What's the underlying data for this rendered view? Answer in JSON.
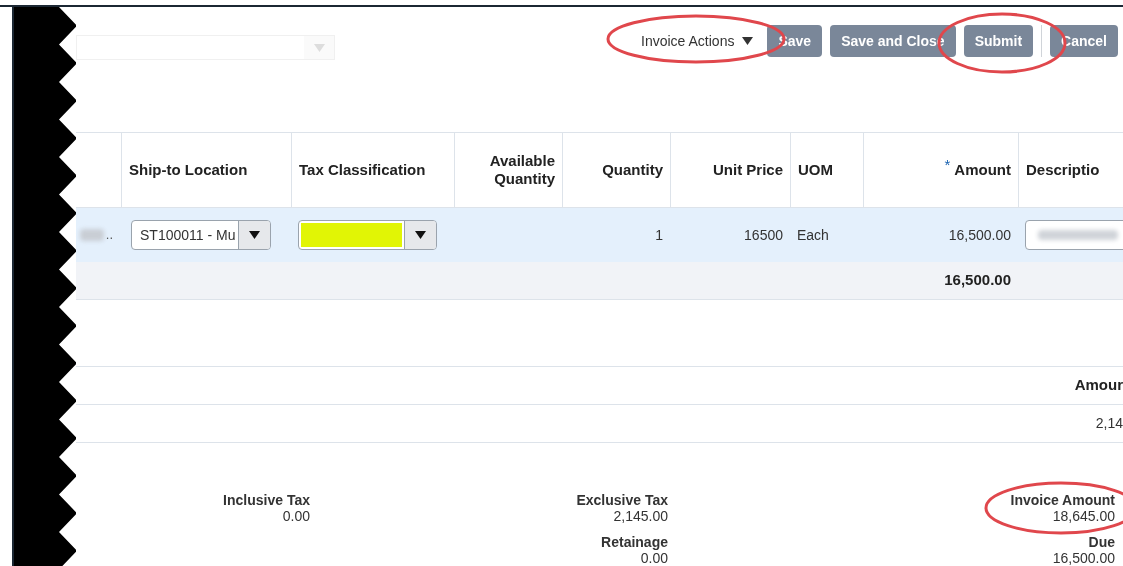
{
  "toolbar": {
    "actions_menu": {
      "label": "Invoice Actions"
    },
    "buttons": [
      {
        "label": "Save"
      },
      {
        "label": "Save and Close"
      },
      {
        "label": "Submit"
      },
      {
        "label": "Cancel"
      }
    ]
  },
  "lines_table": {
    "columns": [
      {},
      {
        "label": "Ship-to Location"
      },
      {
        "label": "Tax Classification"
      },
      {
        "label": "Available Quantity"
      },
      {
        "label": "Quantity"
      },
      {
        "label": "Unit Price"
      },
      {
        "label": "UOM"
      },
      {
        "label": "Amount",
        "required_mark": "*"
      },
      {
        "label": "Descriptio"
      }
    ],
    "rows": [
      {
        "selected": true,
        "cells": [
          {
            "kind": "blurred",
            "text": ".."
          },
          {
            "kind": "dropdown",
            "text": "ST100011 - Mu"
          },
          {
            "kind": "highlighted_dropdown"
          },
          {
            "kind": "empty"
          },
          {
            "kind": "text",
            "text": "1"
          },
          {
            "kind": "text",
            "text": "16500"
          },
          {
            "kind": "text",
            "text": "Each"
          },
          {
            "kind": "text",
            "text": "16,500.00"
          },
          {
            "kind": "blurred_field"
          }
        ]
      }
    ],
    "total": "16,500.00"
  },
  "tax_lines_table": {
    "columns": [
      "Amour"
    ],
    "rows": [
      [
        "2,14"
      ]
    ]
  },
  "summary": [
    [
      {
        "label": "Inclusive Tax",
        "value": "0.00"
      }
    ],
    [
      {
        "label": "Exclusive Tax",
        "value": "2,145.00"
      },
      {
        "label": "Retainage",
        "value": "0.00"
      }
    ],
    [
      {
        "label": "Invoice Amount",
        "value": "18,645.00"
      },
      {
        "label": "Due",
        "value": "16,500.00"
      }
    ]
  ]
}
